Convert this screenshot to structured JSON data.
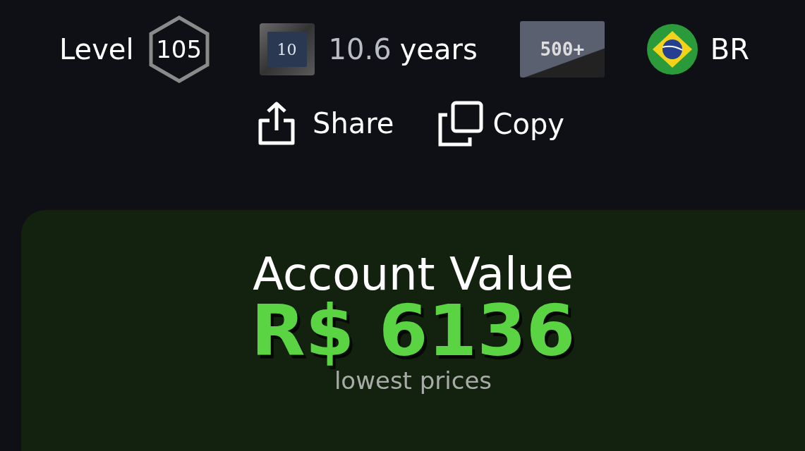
{
  "profile": {
    "level_label": "Level",
    "level": "105",
    "years_badge": "10",
    "years_value": "10.6",
    "years_unit": "years",
    "games_badge": "500+",
    "country": "BR"
  },
  "actions": [
    {
      "kind": "share",
      "label": "Share"
    },
    {
      "kind": "copy",
      "label": "Copy"
    }
  ],
  "account_value": {
    "title": "Account Value",
    "amount": "R$ 6136",
    "note": "lowest prices"
  }
}
